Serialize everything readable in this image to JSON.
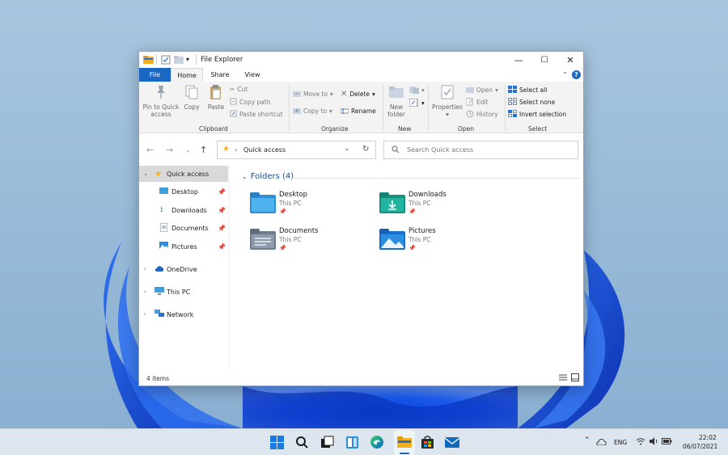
{
  "window": {
    "title": "File Explorer",
    "minimize_glyph": "—",
    "maximize_glyph": "☐",
    "close_glyph": "✕"
  },
  "ribbon": {
    "tabs": {
      "file": "File",
      "home": "Home",
      "share": "Share",
      "view": "View"
    },
    "help": "?",
    "clipboard": {
      "pin_line1": "Pin to Quick",
      "pin_line2": "access",
      "copy": "Copy",
      "paste": "Paste",
      "cut": "Cut",
      "copy_path": "Copy path",
      "paste_shortcut": "Paste shortcut",
      "label": "Clipboard"
    },
    "organize": {
      "move_to": "Move to",
      "copy_to": "Copy to",
      "delete": "Delete",
      "rename": "Rename",
      "label": "Organize"
    },
    "new": {
      "new_folder_line1": "New",
      "new_folder_line2": "folder",
      "label": "New"
    },
    "open": {
      "properties": "Properties",
      "open": "Open",
      "edit": "Edit",
      "history": "History",
      "label": "Open"
    },
    "select": {
      "select_all": "Select all",
      "select_none": "Select none",
      "invert_selection": "Invert selection",
      "label": "Select"
    }
  },
  "address": {
    "separator": "›",
    "location": "Quick access",
    "search_placeholder": "Search Quick access"
  },
  "nav_pane": {
    "quick_access": "Quick access",
    "desktop": "Desktop",
    "downloads": "Downloads",
    "documents": "Documents",
    "pictures": "Pictures",
    "onedrive": "OneDrive",
    "this_pc": "This PC",
    "network": "Network"
  },
  "content": {
    "section_title": "Folders (4)",
    "folders": [
      {
        "name": "Desktop",
        "location": "This PC"
      },
      {
        "name": "Downloads",
        "location": "This PC"
      },
      {
        "name": "Documents",
        "location": "This PC"
      },
      {
        "name": "Pictures",
        "location": "This PC"
      }
    ]
  },
  "status": {
    "item_count": "4 items"
  },
  "taskbar": {
    "language": "ENG",
    "time": "22:02",
    "date": "06/07/2021"
  },
  "colors": {
    "accent": "#1a68c4",
    "selected_nav": "#d9d9d9",
    "folder_blue": "#3aa0de",
    "folder_teal": "#1fa99a"
  }
}
